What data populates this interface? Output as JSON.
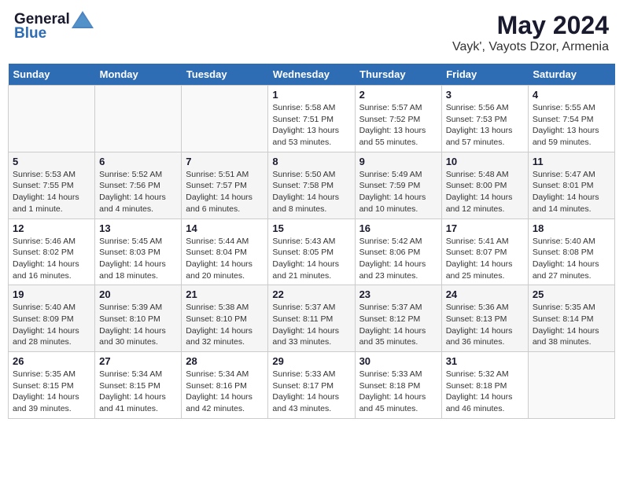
{
  "header": {
    "logo_general": "General",
    "logo_blue": "Blue",
    "month_title": "May 2024",
    "location": "Vayk', Vayots Dzor, Armenia"
  },
  "days_of_week": [
    "Sunday",
    "Monday",
    "Tuesday",
    "Wednesday",
    "Thursday",
    "Friday",
    "Saturday"
  ],
  "weeks": [
    [
      {
        "day": "",
        "info": ""
      },
      {
        "day": "",
        "info": ""
      },
      {
        "day": "",
        "info": ""
      },
      {
        "day": "1",
        "info": "Sunrise: 5:58 AM\nSunset: 7:51 PM\nDaylight: 13 hours\nand 53 minutes."
      },
      {
        "day": "2",
        "info": "Sunrise: 5:57 AM\nSunset: 7:52 PM\nDaylight: 13 hours\nand 55 minutes."
      },
      {
        "day": "3",
        "info": "Sunrise: 5:56 AM\nSunset: 7:53 PM\nDaylight: 13 hours\nand 57 minutes."
      },
      {
        "day": "4",
        "info": "Sunrise: 5:55 AM\nSunset: 7:54 PM\nDaylight: 13 hours\nand 59 minutes."
      }
    ],
    [
      {
        "day": "5",
        "info": "Sunrise: 5:53 AM\nSunset: 7:55 PM\nDaylight: 14 hours\nand 1 minute."
      },
      {
        "day": "6",
        "info": "Sunrise: 5:52 AM\nSunset: 7:56 PM\nDaylight: 14 hours\nand 4 minutes."
      },
      {
        "day": "7",
        "info": "Sunrise: 5:51 AM\nSunset: 7:57 PM\nDaylight: 14 hours\nand 6 minutes."
      },
      {
        "day": "8",
        "info": "Sunrise: 5:50 AM\nSunset: 7:58 PM\nDaylight: 14 hours\nand 8 minutes."
      },
      {
        "day": "9",
        "info": "Sunrise: 5:49 AM\nSunset: 7:59 PM\nDaylight: 14 hours\nand 10 minutes."
      },
      {
        "day": "10",
        "info": "Sunrise: 5:48 AM\nSunset: 8:00 PM\nDaylight: 14 hours\nand 12 minutes."
      },
      {
        "day": "11",
        "info": "Sunrise: 5:47 AM\nSunset: 8:01 PM\nDaylight: 14 hours\nand 14 minutes."
      }
    ],
    [
      {
        "day": "12",
        "info": "Sunrise: 5:46 AM\nSunset: 8:02 PM\nDaylight: 14 hours\nand 16 minutes."
      },
      {
        "day": "13",
        "info": "Sunrise: 5:45 AM\nSunset: 8:03 PM\nDaylight: 14 hours\nand 18 minutes."
      },
      {
        "day": "14",
        "info": "Sunrise: 5:44 AM\nSunset: 8:04 PM\nDaylight: 14 hours\nand 20 minutes."
      },
      {
        "day": "15",
        "info": "Sunrise: 5:43 AM\nSunset: 8:05 PM\nDaylight: 14 hours\nand 21 minutes."
      },
      {
        "day": "16",
        "info": "Sunrise: 5:42 AM\nSunset: 8:06 PM\nDaylight: 14 hours\nand 23 minutes."
      },
      {
        "day": "17",
        "info": "Sunrise: 5:41 AM\nSunset: 8:07 PM\nDaylight: 14 hours\nand 25 minutes."
      },
      {
        "day": "18",
        "info": "Sunrise: 5:40 AM\nSunset: 8:08 PM\nDaylight: 14 hours\nand 27 minutes."
      }
    ],
    [
      {
        "day": "19",
        "info": "Sunrise: 5:40 AM\nSunset: 8:09 PM\nDaylight: 14 hours\nand 28 minutes."
      },
      {
        "day": "20",
        "info": "Sunrise: 5:39 AM\nSunset: 8:10 PM\nDaylight: 14 hours\nand 30 minutes."
      },
      {
        "day": "21",
        "info": "Sunrise: 5:38 AM\nSunset: 8:10 PM\nDaylight: 14 hours\nand 32 minutes."
      },
      {
        "day": "22",
        "info": "Sunrise: 5:37 AM\nSunset: 8:11 PM\nDaylight: 14 hours\nand 33 minutes."
      },
      {
        "day": "23",
        "info": "Sunrise: 5:37 AM\nSunset: 8:12 PM\nDaylight: 14 hours\nand 35 minutes."
      },
      {
        "day": "24",
        "info": "Sunrise: 5:36 AM\nSunset: 8:13 PM\nDaylight: 14 hours\nand 36 minutes."
      },
      {
        "day": "25",
        "info": "Sunrise: 5:35 AM\nSunset: 8:14 PM\nDaylight: 14 hours\nand 38 minutes."
      }
    ],
    [
      {
        "day": "26",
        "info": "Sunrise: 5:35 AM\nSunset: 8:15 PM\nDaylight: 14 hours\nand 39 minutes."
      },
      {
        "day": "27",
        "info": "Sunrise: 5:34 AM\nSunset: 8:15 PM\nDaylight: 14 hours\nand 41 minutes."
      },
      {
        "day": "28",
        "info": "Sunrise: 5:34 AM\nSunset: 8:16 PM\nDaylight: 14 hours\nand 42 minutes."
      },
      {
        "day": "29",
        "info": "Sunrise: 5:33 AM\nSunset: 8:17 PM\nDaylight: 14 hours\nand 43 minutes."
      },
      {
        "day": "30",
        "info": "Sunrise: 5:33 AM\nSunset: 8:18 PM\nDaylight: 14 hours\nand 45 minutes."
      },
      {
        "day": "31",
        "info": "Sunrise: 5:32 AM\nSunset: 8:18 PM\nDaylight: 14 hours\nand 46 minutes."
      },
      {
        "day": "",
        "info": ""
      }
    ]
  ]
}
